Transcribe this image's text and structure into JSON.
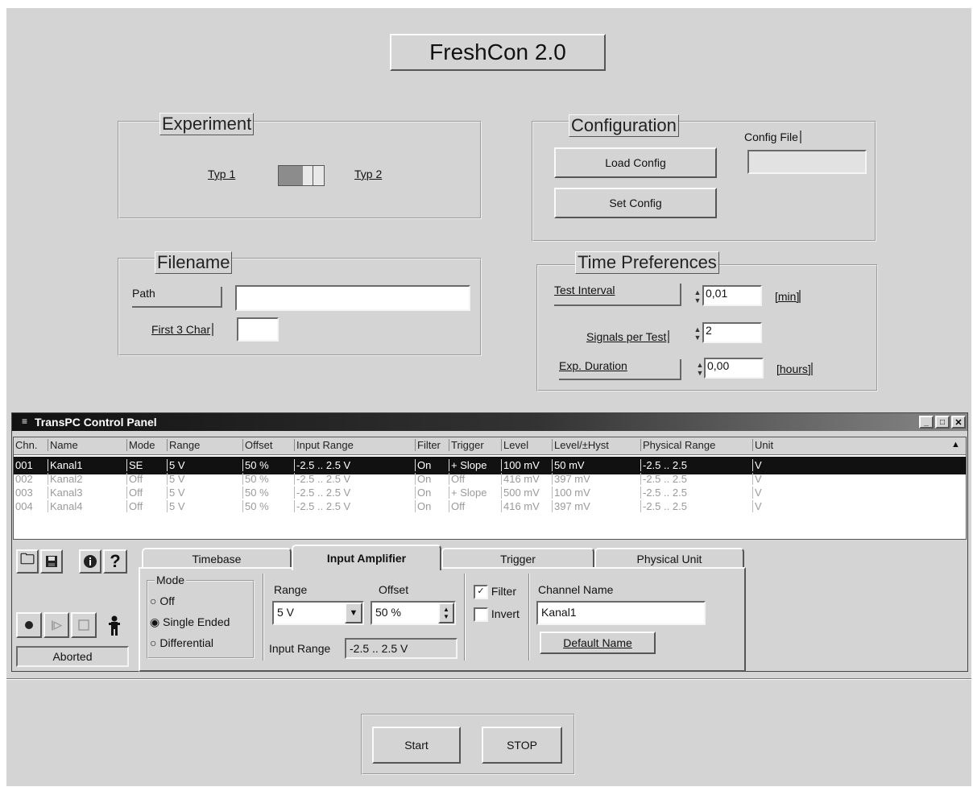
{
  "app_title": "FreshCon 2.0",
  "experiment": {
    "title": "Experiment",
    "typ1": "Typ 1",
    "typ2": "Typ 2"
  },
  "configuration": {
    "title": "Configuration",
    "load_button": "Load Config",
    "set_button": "Set Config",
    "config_file_label": "Config File",
    "config_file_value": ""
  },
  "filename": {
    "title": "Filename",
    "path_label": "Path",
    "path_value": "",
    "first3_label": "First 3 Char",
    "first3_value": ""
  },
  "time_prefs": {
    "title": "Time Preferences",
    "test_interval_label": "Test Interval",
    "test_interval_value": "0,01",
    "test_interval_unit": "[min]",
    "signals_label": "Signals per Test",
    "signals_value": "2",
    "duration_label": "Exp. Duration",
    "duration_value": "0,00",
    "duration_unit": "[hours]"
  },
  "control_panel": {
    "title": "TransPC Control Panel",
    "columns": [
      "Chn.",
      "Name",
      "Mode",
      "Range",
      "Offset",
      "Input Range",
      "Filter",
      "Trigger",
      "Level",
      "Level/±Hyst",
      "Physical Range",
      "Unit"
    ],
    "rows": [
      [
        "001",
        "Kanal1",
        "SE",
        "5 V",
        "50 %",
        "-2.5 .. 2.5 V",
        "On",
        "+ Slope",
        "100 mV",
        "50 mV",
        "-2.5 .. 2.5",
        "V"
      ],
      [
        "002",
        "Kanal2",
        "Off",
        "5 V",
        "50 %",
        "-2.5 .. 2.5 V",
        "On",
        "Off",
        "416 mV",
        "397 mV",
        "-2.5 .. 2.5",
        "V"
      ],
      [
        "003",
        "Kanal3",
        "Off",
        "5 V",
        "50 %",
        "-2.5 .. 2.5 V",
        "On",
        "+ Slope",
        "500 mV",
        "100 mV",
        "-2.5 .. 2.5",
        "V"
      ],
      [
        "004",
        "Kanal4",
        "Off",
        "5 V",
        "50 %",
        "-2.5 .. 2.5 V",
        "On",
        "Off",
        "416 mV",
        "397 mV",
        "-2.5 .. 2.5",
        "V"
      ]
    ],
    "status": "Aborted",
    "tabs": [
      "Timebase",
      "Input Amplifier",
      "Trigger",
      "Physical Unit"
    ],
    "active_tab": "Input Amplifier",
    "mode": {
      "title": "Mode",
      "options": [
        "Off",
        "Single Ended",
        "Differential"
      ],
      "selected": "Single Ended"
    },
    "range_label": "Range",
    "range_value": "5 V",
    "offset_label": "Offset",
    "offset_value": "50 %",
    "input_range_label": "Input Range",
    "input_range_value": "-2.5 .. 2.5 V",
    "filter_label": "Filter",
    "filter_checked": true,
    "invert_label": "Invert",
    "invert_checked": false,
    "channel_name_label": "Channel Name",
    "channel_name_value": "Kanal1",
    "default_name_button": "Default Name"
  },
  "footer": {
    "start_button": "Start",
    "stop_button": "STOP"
  }
}
